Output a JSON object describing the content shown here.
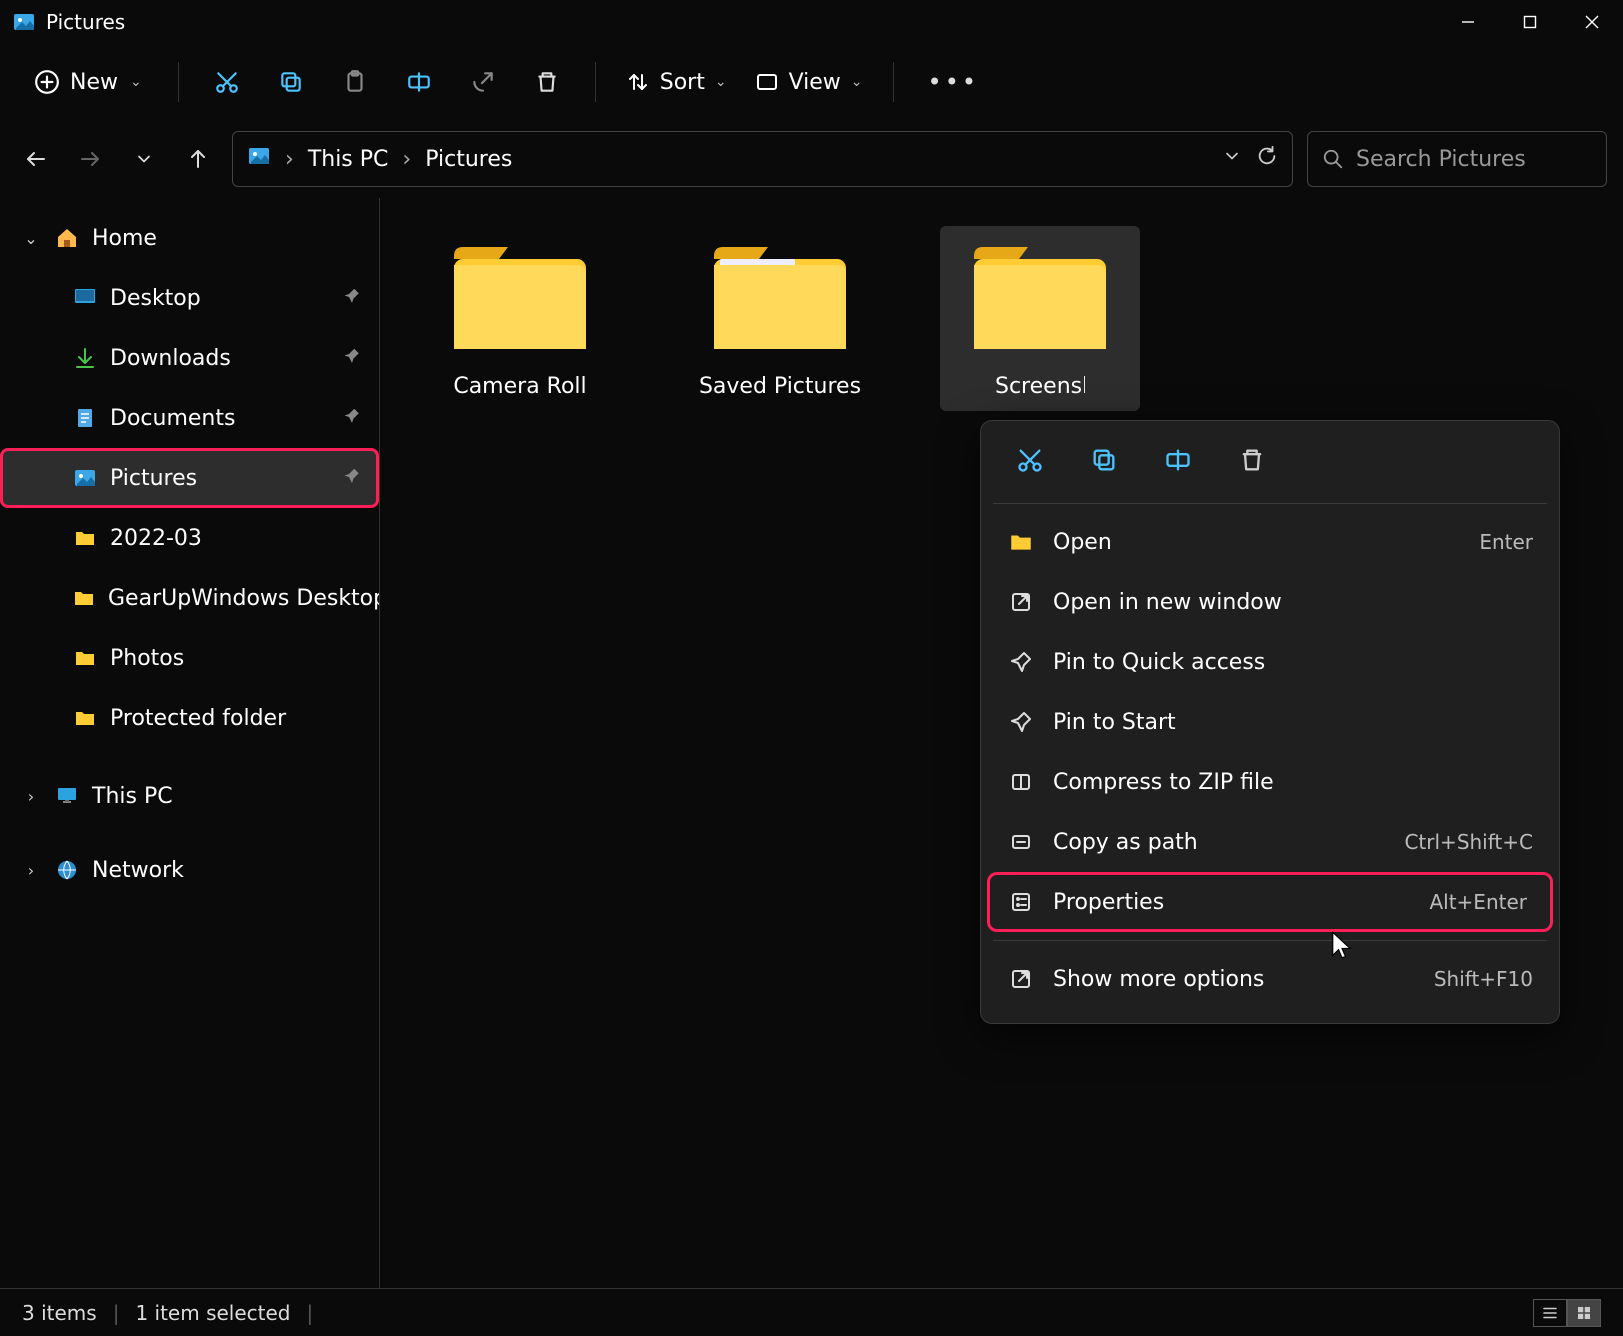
{
  "window": {
    "title": "Pictures"
  },
  "toolbar": {
    "new_label": "New",
    "sort_label": "Sort",
    "view_label": "View"
  },
  "breadcrumbs": {
    "seg0": "This PC",
    "seg1": "Pictures"
  },
  "search": {
    "placeholder": "Search Pictures"
  },
  "sidebar": {
    "items": [
      {
        "label": "Home",
        "icon": "home",
        "expanded": true,
        "pinned": false
      },
      {
        "label": "Desktop",
        "icon": "desktop",
        "indent": 1,
        "pinned": true
      },
      {
        "label": "Downloads",
        "icon": "downloads",
        "indent": 1,
        "pinned": true
      },
      {
        "label": "Documents",
        "icon": "documents",
        "indent": 1,
        "pinned": true
      },
      {
        "label": "Pictures",
        "icon": "pictures",
        "indent": 1,
        "pinned": true,
        "active": true,
        "highlighted": true
      },
      {
        "label": "2022-03",
        "icon": "folder",
        "indent": 1,
        "pinned": false
      },
      {
        "label": "GearUpWindows Desktop",
        "icon": "folder",
        "indent": 1,
        "pinned": false
      },
      {
        "label": "Photos",
        "icon": "folder",
        "indent": 1,
        "pinned": false
      },
      {
        "label": "Protected folder",
        "icon": "folder",
        "indent": 1,
        "pinned": false
      },
      {
        "label": "This PC",
        "icon": "thispc",
        "expandable": true
      },
      {
        "label": "Network",
        "icon": "network",
        "expandable": true
      }
    ]
  },
  "folders": [
    {
      "label": "Camera Roll",
      "selected": false
    },
    {
      "label": "Saved Pictures",
      "selected": false
    },
    {
      "label": "Screenshots",
      "selected": true
    }
  ],
  "context_menu": {
    "items": [
      {
        "label": "Open",
        "shortcut": "Enter",
        "icon": "folder"
      },
      {
        "label": "Open in new window",
        "shortcut": "",
        "icon": "open-external"
      },
      {
        "label": "Pin to Quick access",
        "shortcut": "",
        "icon": "pin"
      },
      {
        "label": "Pin to Start",
        "shortcut": "",
        "icon": "pin"
      },
      {
        "label": "Compress to ZIP file",
        "shortcut": "",
        "icon": "zip"
      },
      {
        "label": "Copy as path",
        "shortcut": "Ctrl+Shift+C",
        "icon": "path"
      },
      {
        "label": "Properties",
        "shortcut": "Alt+Enter",
        "icon": "properties",
        "highlighted": true
      },
      {
        "label": "Show more options",
        "shortcut": "Shift+F10",
        "icon": "more"
      }
    ]
  },
  "statusbar": {
    "count": "3 items",
    "selected": "1 item selected"
  }
}
